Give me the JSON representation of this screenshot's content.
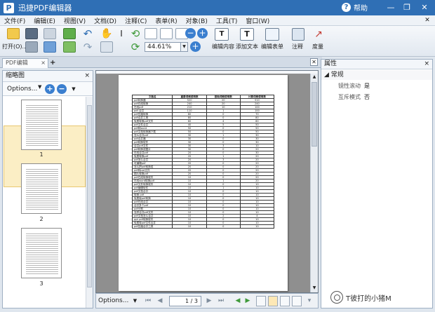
{
  "window": {
    "app_logo": "P",
    "title": "迅捷PDF编辑器",
    "help_label": "帮助"
  },
  "menu": [
    "文件(F)",
    "编辑(E)",
    "视图(V)",
    "文档(D)",
    "注释(C)",
    "表单(R)",
    "对象(B)",
    "工具(T)",
    "窗口(W)"
  ],
  "toolbar": {
    "open_label": "打开(O)...",
    "zoom_value": "44.61%",
    "edit_content_label": "编辑内容",
    "add_text_label": "添加文本",
    "edit_form_label": "编辑表单",
    "annotate_label": "注释",
    "measure_label": "度量"
  },
  "tab": {
    "doc_title": "PDF编辑"
  },
  "thumb_panel": {
    "title": "缩略图",
    "options_label": "Options...",
    "pages": [
      {
        "label": "1"
      },
      {
        "label": "2"
      },
      {
        "label": "3"
      }
    ],
    "selected_page": 1
  },
  "document": {
    "table_headers": [
      "文档名",
      "重要词频使用数",
      "基础词频使用数",
      "计算词频使用数"
    ],
    "rows": [
      [
        "pdf转换器",
        "520",
        "20",
        "510"
      ],
      [
        "pdf在线转换",
        "240",
        "20",
        "240"
      ],
      [
        "在线pdf",
        "210",
        "10",
        "100"
      ],
      [
        "pdf 合并",
        "110",
        "1",
        "100"
      ],
      [
        "pdf压缩转换",
        "80",
        "0",
        "70"
      ],
      [
        "pdf合并工具",
        "80",
        "0",
        "80"
      ],
      [
        "免费转换pdf文件",
        "60",
        "4",
        "60"
      ],
      [
        "pdf文件合并",
        "40",
        "5",
        "50"
      ],
      [
        "pdf转word",
        "50",
        "0",
        "50"
      ],
      [
        "pdf文档转换器下载",
        "50",
        "0",
        "50"
      ],
      [
        "怎么合并pdf",
        "30",
        "1",
        "30"
      ],
      [
        "pdf合并器",
        "30",
        "0",
        "30"
      ],
      [
        "pdf转换软件",
        "30",
        "0",
        "30"
      ],
      [
        "合并pdf文件",
        "30",
        "3",
        "10"
      ],
      [
        "pdf转换成图片",
        "30",
        "0",
        "20"
      ],
      [
        "在线合并pdf",
        "20",
        "0",
        "30"
      ],
      [
        "免费转换pdf",
        "20",
        "1",
        "20"
      ],
      [
        "pdf怎么合并",
        "20",
        "3",
        "20"
      ],
      [
        "可编辑pdf",
        "20",
        "0",
        "20"
      ],
      [
        "怎么把pdf转换成",
        "20",
        "0",
        "20"
      ],
      [
        "pdf转ppt文件",
        "20",
        "0",
        "20"
      ],
      [
        "图片转换pdf",
        "20",
        "0",
        "20"
      ],
      [
        "pdf在线转换软件",
        "10",
        "0",
        "20"
      ],
      [
        "在线word转换pdf",
        "10",
        "1",
        "20"
      ],
      [
        "pdf文件转换软件",
        "10",
        "0",
        "10"
      ],
      [
        "pdf编辑软件",
        "10",
        "1",
        "10"
      ],
      [
        "pdf文档合并",
        "10",
        "0",
        "10"
      ],
      [
        "转换 pdf",
        "10",
        "0",
        "10"
      ],
      [
        "免费版pdf转换",
        "10",
        "0",
        "10"
      ],
      [
        "pdf在线合并",
        "10",
        "0",
        "10"
      ],
      [
        "合并多个pdf",
        "10",
        "0",
        "10"
      ],
      [
        "pdf分割",
        "10",
        "0",
        "10"
      ],
      [
        "怎样合并pdf文件",
        "10",
        "0",
        "10"
      ],
      [
        "pdf文档怎么合并",
        "10",
        "2",
        "4"
      ],
      [
        "ppt pdf转换软件",
        "10",
        "0",
        "10"
      ],
      [
        "免费转pdf文件合并",
        "10",
        "0",
        "10"
      ],
      [
        "pdf压缩合并工具",
        "10",
        "0",
        "10"
      ]
    ]
  },
  "bottom_bar": {
    "options_label": "Options...",
    "page_indicator": "1 / 3"
  },
  "properties": {
    "title": "属性",
    "group": "常规",
    "rows": [
      {
        "name": "镜性滚动",
        "value": "是"
      },
      {
        "name": "互斥模式",
        "value": "否"
      }
    ]
  },
  "watermark": {
    "text": "T彼打的小猪M"
  },
  "colors": {
    "titlebar": "#2f6fb5",
    "accent": "#3b7fcf",
    "selection": "#fbeec5"
  }
}
